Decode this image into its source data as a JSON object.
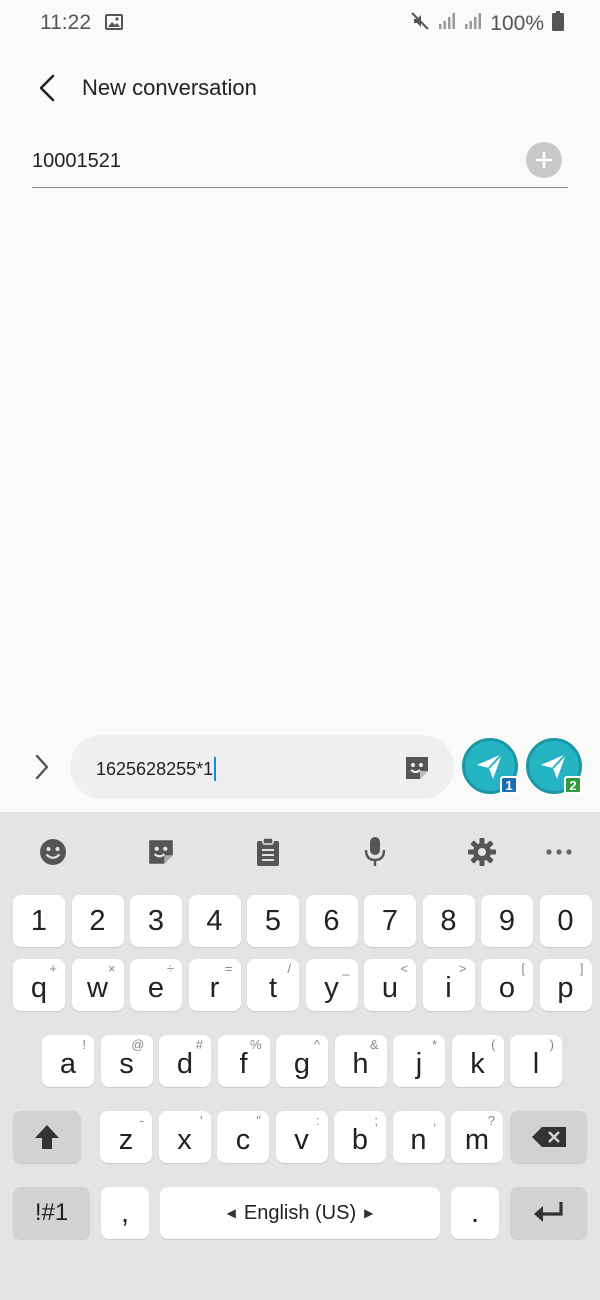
{
  "status_bar": {
    "time": "11:22",
    "battery": "100%",
    "icons": [
      "gallery-icon",
      "mute-icon",
      "signal-icon",
      "signal-icon",
      "battery-icon"
    ]
  },
  "app_bar": {
    "title": "New conversation"
  },
  "recipient": {
    "value": "10001521"
  },
  "composer": {
    "message": "1625628255*1",
    "send_buttons": [
      {
        "sim": "1",
        "color": "#1a6fb5"
      },
      {
        "sim": "2",
        "color": "#2f9a3b"
      }
    ]
  },
  "keyboard": {
    "toolbar": [
      "emoji-icon",
      "sticker-icon",
      "clipboard-icon",
      "microphone-icon",
      "settings-icon",
      "more-icon"
    ],
    "row_numbers": [
      "1",
      "2",
      "3",
      "4",
      "5",
      "6",
      "7",
      "8",
      "9",
      "0"
    ],
    "row1": [
      {
        "k": "q",
        "s": "+"
      },
      {
        "k": "w",
        "s": "×"
      },
      {
        "k": "e",
        "s": "÷"
      },
      {
        "k": "r",
        "s": "="
      },
      {
        "k": "t",
        "s": "/"
      },
      {
        "k": "y",
        "s": "_"
      },
      {
        "k": "u",
        "s": "<"
      },
      {
        "k": "i",
        "s": ">"
      },
      {
        "k": "o",
        "s": "["
      },
      {
        "k": "p",
        "s": "]"
      }
    ],
    "row2": [
      {
        "k": "a",
        "s": "!"
      },
      {
        "k": "s",
        "s": "@"
      },
      {
        "k": "d",
        "s": "#"
      },
      {
        "k": "f",
        "s": "%"
      },
      {
        "k": "g",
        "s": "^"
      },
      {
        "k": "h",
        "s": "&"
      },
      {
        "k": "j",
        "s": "*"
      },
      {
        "k": "k",
        "s": "("
      },
      {
        "k": "l",
        "s": ")"
      }
    ],
    "row3": [
      {
        "k": "z",
        "s": "-"
      },
      {
        "k": "x",
        "s": "'"
      },
      {
        "k": "c",
        "s": "\""
      },
      {
        "k": "v",
        "s": ":"
      },
      {
        "k": "b",
        "s": ";"
      },
      {
        "k": "n",
        "s": ","
      },
      {
        "k": "m",
        "s": "?"
      }
    ],
    "symbols_label": "!#1",
    "comma_label": ",",
    "space_label": "English (US)",
    "period_label": "."
  },
  "colors": {
    "accent": "#24b4c2",
    "caret": "#1b8bd6",
    "keyboard_bg": "#e4e4e4"
  }
}
